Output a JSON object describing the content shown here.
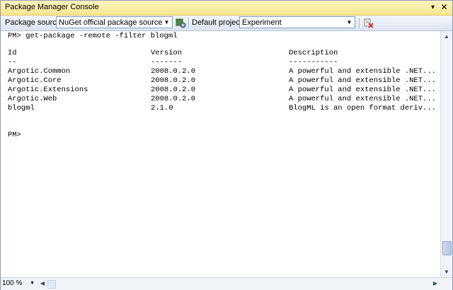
{
  "window": {
    "title": "Package Manager Console"
  },
  "titlebar": {
    "pin_glyph": "▾",
    "close_glyph": "✕"
  },
  "toolbar": {
    "source_label": "Package source:",
    "source_value": "NuGet official package source",
    "project_label": "Default project:",
    "project_value": "Experiment"
  },
  "console": {
    "command": "PM> get-package -remote -filter blogml",
    "headers": [
      "Id",
      "Version",
      "Description"
    ],
    "separators": [
      "--",
      "-------",
      "-----------"
    ],
    "rows": [
      [
        "Argotic.Common",
        "2008.0.2.0",
        "A powerful and extensible .NET..."
      ],
      [
        "Argotic.Core",
        "2008.0.2.0",
        "A powerful and extensible .NET..."
      ],
      [
        "Argotic.Extensions",
        "2008.0.2.0",
        "A powerful and extensible .NET..."
      ],
      [
        "Argotic.Web",
        "2008.0.2.0",
        "A powerful and extensible .NET..."
      ],
      [
        "blogml",
        "2.1.0",
        "BlogML is an open format deriv..."
      ]
    ],
    "prompt": "PM>"
  },
  "bottombar": {
    "zoom": "100 %"
  },
  "icons": {
    "settings": "package-settings-icon",
    "clear": "clear-console-icon"
  }
}
